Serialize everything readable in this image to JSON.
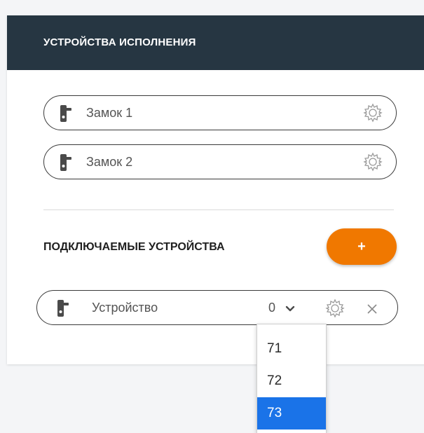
{
  "panel": {
    "title": "УСТРОЙСТВА ИСПОЛНЕНИЯ",
    "header_color": "#263642"
  },
  "devices": [
    {
      "name": "Замок 1",
      "icon": "lock-handle-icon",
      "action_icon": "gear-icon"
    },
    {
      "name": "Замок 2",
      "icon": "lock-handle-icon",
      "action_icon": "gear-icon"
    }
  ],
  "connected": {
    "title": "ПОДКЛЮЧАЕМЫЕ УСТРОЙСТВА",
    "add_label": "+",
    "add_color": "#f07800",
    "device": {
      "name": "Устройство",
      "select_value": "0",
      "icon": "lock-handle-icon"
    },
    "dropdown": {
      "options": [
        "71",
        "72",
        "73"
      ],
      "selected": "73",
      "selected_color": "#1a73e8"
    }
  }
}
